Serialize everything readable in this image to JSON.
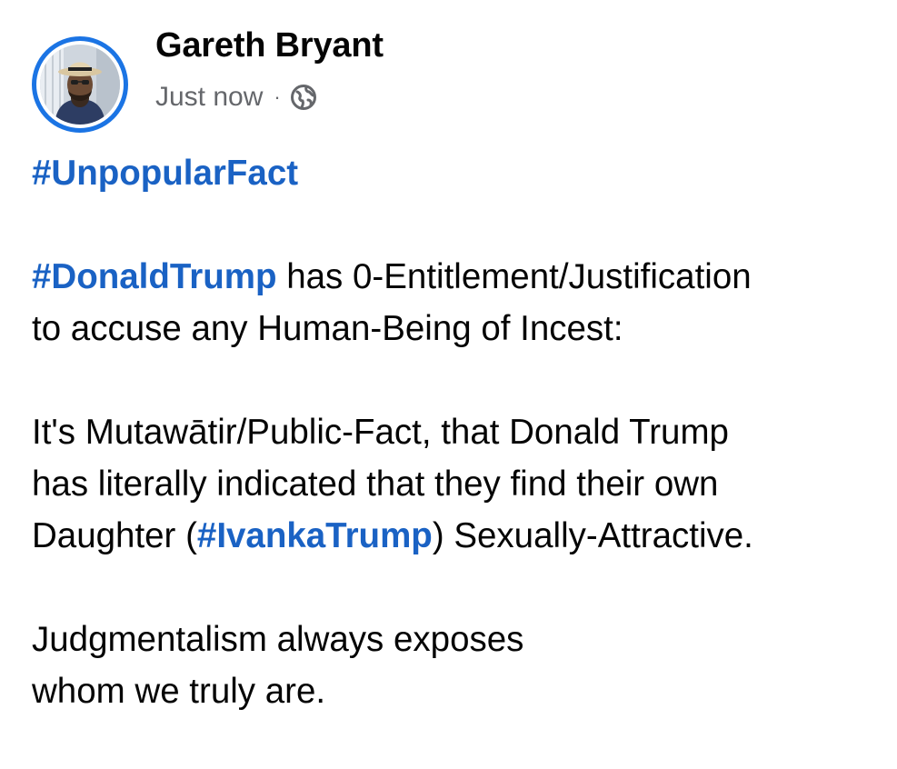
{
  "post": {
    "author": "Gareth Bryant",
    "timestamp": "Just now",
    "separator": "·",
    "privacy_icon": "globe-icon",
    "avatar_ring_color": "#1b74e4",
    "hashtag_color": "#1a62c4",
    "paragraphs": {
      "p1": {
        "tag": "#UnpopularFact"
      },
      "p2": {
        "tag": "#DonaldTrump",
        "text_a": " has 0-Entitlement/Justification",
        "text_b": "to accuse any Human-Being of Incest:"
      },
      "p3": {
        "line1": "It's Mutawātir/Public-Fact, that Donald Trump",
        "line2": "has literally indicated that they find their own",
        "line3_before": "Daughter (",
        "tag": "#IvankaTrump",
        "line3_after": ") Sexually-Attractive."
      },
      "p4": {
        "line1": "Judgmentalism always exposes",
        "line2": "whom we truly are."
      }
    }
  }
}
